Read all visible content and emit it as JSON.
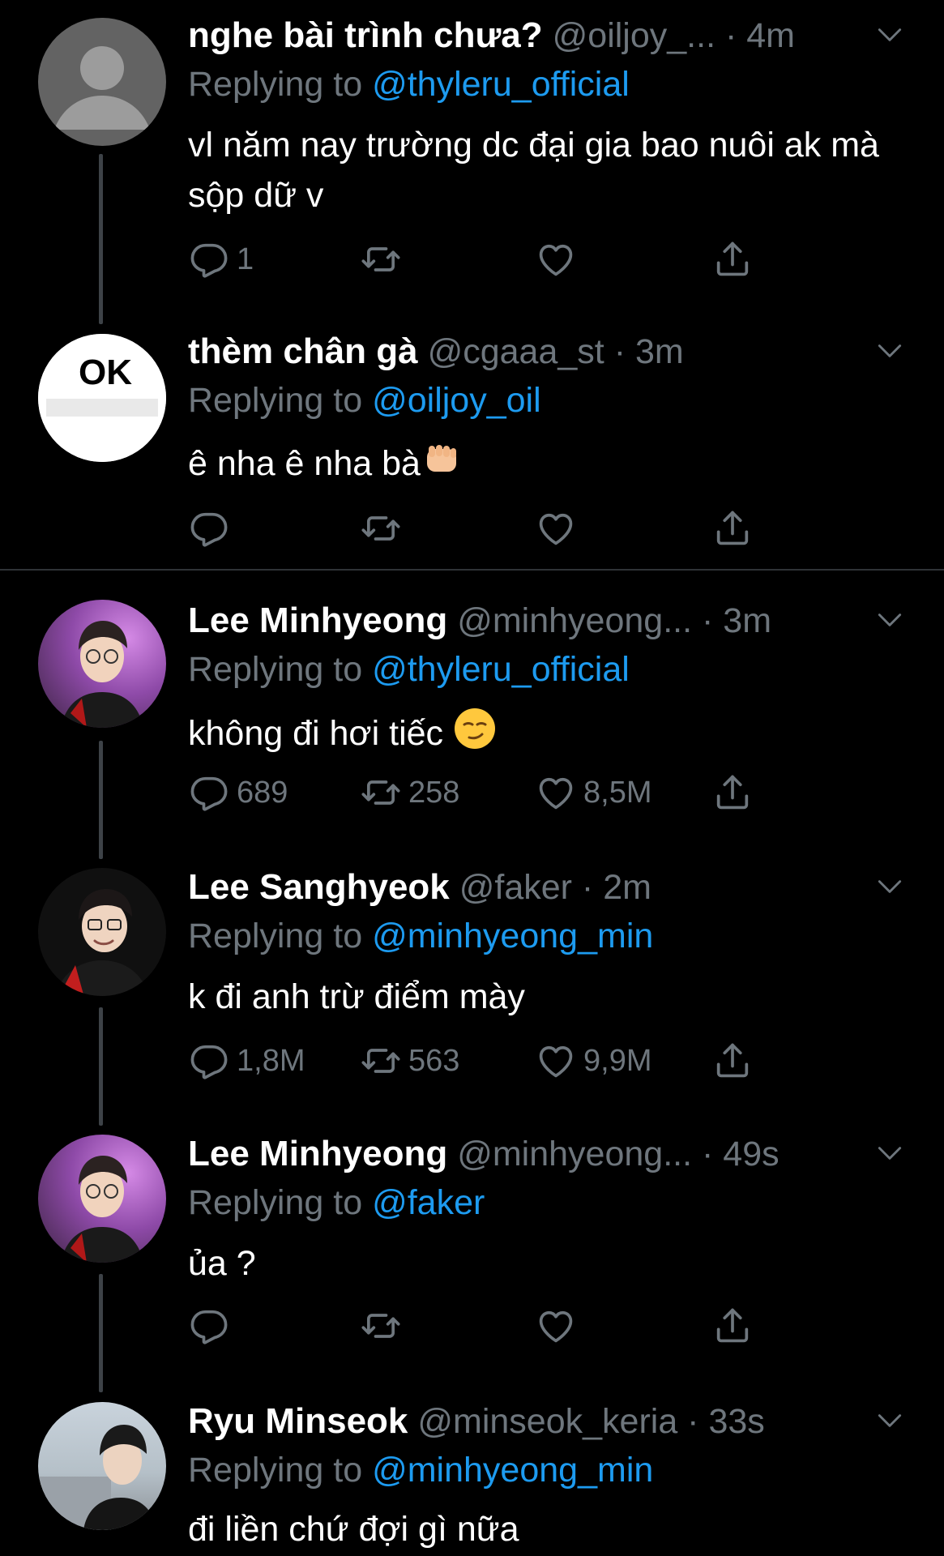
{
  "tweets": [
    {
      "name": "nghe bài trình chưa?",
      "handle": "@oiljoy_...",
      "sep": " · ",
      "time": "4m",
      "reply_prefix": "Replying to ",
      "reply_to": "@thyleru_official",
      "text": "vl năm nay trường dc đại gia bao nuôi ak mà sộp dữ v",
      "replies": "1",
      "retweets": "",
      "likes": ""
    },
    {
      "name": "thèm chân gà",
      "handle": "@cgaaa_st",
      "sep": " · ",
      "time": "3m",
      "reply_prefix": "Replying to ",
      "reply_to": "@oiljoy_oil",
      "text": "ê nha ê nha bà",
      "avatar_text": "OK",
      "replies": "",
      "retweets": "",
      "likes": ""
    },
    {
      "name": "Lee Minhyeong",
      "handle": "@minhyeong...",
      "sep": " · ",
      "time": "3m",
      "reply_prefix": "Replying to ",
      "reply_to": "@thyleru_official",
      "text": "không đi hơi tiếc",
      "replies": "689",
      "retweets": "258",
      "likes": "8,5M"
    },
    {
      "name": "Lee Sanghyeok",
      "handle": "@faker",
      "sep": " · ",
      "time": "2m",
      "reply_prefix": "Replying to ",
      "reply_to": "@minhyeong_min",
      "text": "k đi anh trừ điểm mày",
      "replies": "1,8M",
      "retweets": "563",
      "likes": "9,9M"
    },
    {
      "name": "Lee Minhyeong",
      "handle": "@minhyeong...",
      "sep": " · ",
      "time": "49s",
      "reply_prefix": "Replying to ",
      "reply_to": "@faker",
      "text": "ủa ?",
      "replies": "",
      "retweets": "",
      "likes": ""
    },
    {
      "name": "Ryu Minseok",
      "handle": "@minseok_keria",
      "sep": " · ",
      "time": "33s",
      "reply_prefix": "Replying to ",
      "reply_to": "@minhyeong_min",
      "text": "đi liền chứ đợi gì nữa"
    }
  ],
  "icons": {
    "reply": "reply-icon",
    "retweet": "retweet-icon",
    "like": "heart-icon",
    "share": "share-icon",
    "caret": "chevron-down-icon"
  },
  "colors": {
    "background": "#000000",
    "text": "#ffffff",
    "secondary": "#6e767d",
    "mention": "#1d9bf0",
    "thread_line": "#3d4247"
  }
}
